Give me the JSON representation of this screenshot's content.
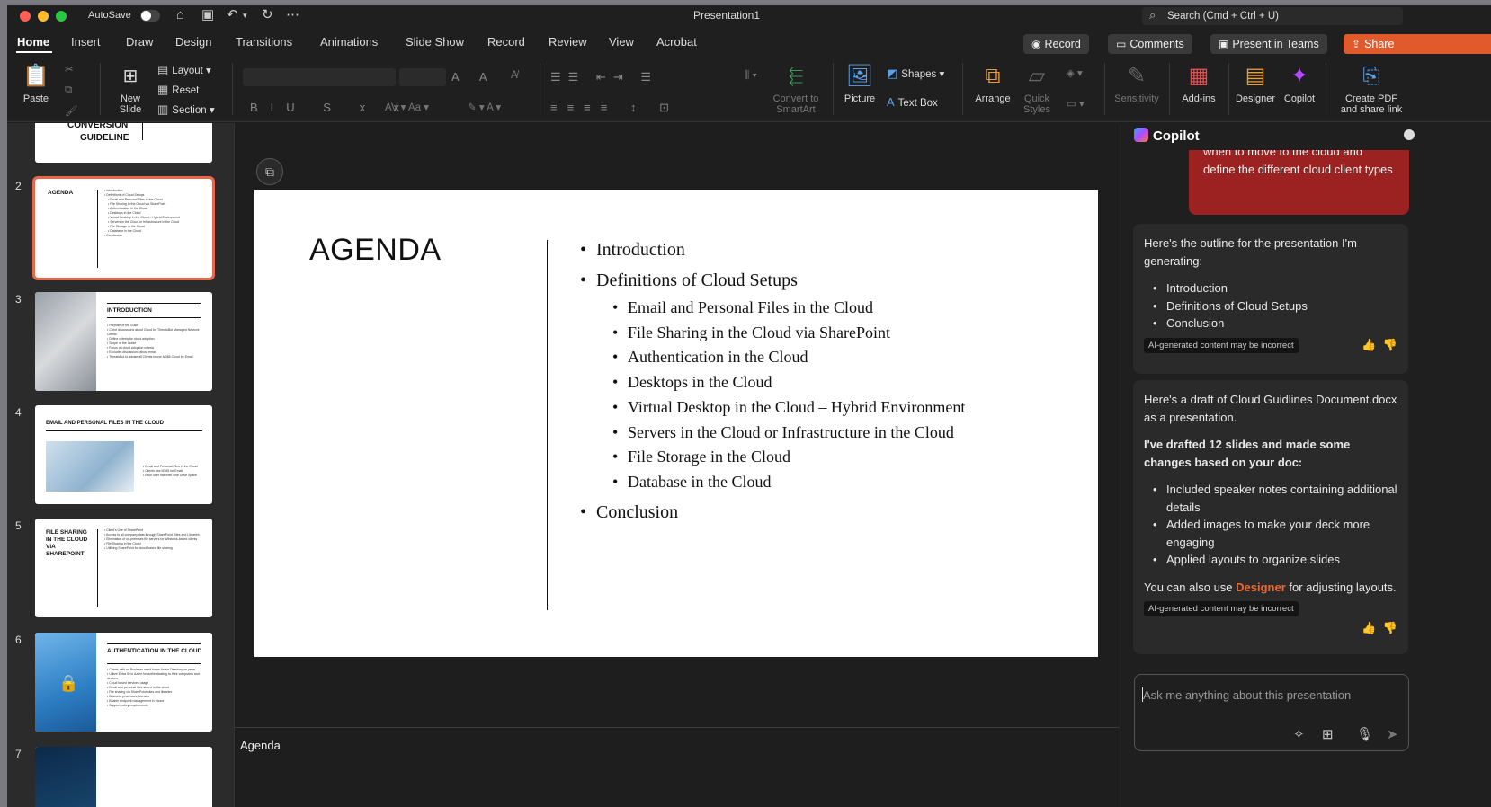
{
  "window": {
    "title": "Presentation1"
  },
  "titlebar": {
    "autosave_label": "AutoSave",
    "search_placeholder": "Search (Cmd + Ctrl + U)"
  },
  "tabs": [
    "Home",
    "Insert",
    "Draw",
    "Design",
    "Transitions",
    "Animations",
    "Slide Show",
    "Record",
    "Review",
    "View",
    "Acrobat"
  ],
  "actions": {
    "record": "Record",
    "comments": "Comments",
    "present_teams": "Present in Teams",
    "share": "Share"
  },
  "ribbon": {
    "paste": "Paste",
    "new_slide": "New\nSlide",
    "layout": "Layout",
    "reset": "Reset",
    "section": "Section",
    "convert_smartart": "Convert to\nSmartArt",
    "picture": "Picture",
    "shapes": "Shapes",
    "text_box": "Text Box",
    "arrange": "Arrange",
    "quick_styles": "Quick\nStyles",
    "sensitivity": "Sensitivity",
    "addins": "Add-ins",
    "designer": "Designer",
    "copilot": "Copilot",
    "create_pdf": "Create PDF\nand share link"
  },
  "thumbnails": {
    "slide1_title": "GUIDELINE",
    "slide1_title_cut": "CONVERSION",
    "slide2": {
      "num": "2",
      "title": "AGENDA",
      "body": [
        "• Introduction",
        "• Definitions of Cloud Setups",
        "   • Email and Personal Files in the Cloud",
        "   • File Sharing in the Cloud via SharePoint",
        "   • Authentication in the Cloud",
        "   • Desktops in the Cloud",
        "   • Virtual Desktop in the Cloud – Hybrid Environment",
        "   • Servers in the Cloud or Infrastructure in the Cloud",
        "   • File Storage in the Cloud",
        "   • Database in the Cloud",
        "• Conclusion"
      ]
    },
    "slide3": {
      "num": "3",
      "title": "INTRODUCTION",
      "body": [
        "• Purpose of the Guide",
        "   • Client discussions about Cloud for ThreatsBut Managed Network Clients",
        "   • Define criteria for cloud adoption",
        "• Scope of the Guide",
        "   • Focus on cloud adoption criteria",
        "   • Excludes discussions about email",
        "   • ThreatsBut to advise all Clients to use M365 Cloud for Email"
      ]
    },
    "slide4": {
      "num": "4",
      "title": "EMAIL AND PERSONAL FILES IN THE CLOUD",
      "body": [
        "• Email and Personal Files in the Cloud",
        "   • Clients use M365 for Email",
        "   • Each user has their One Drive Space"
      ]
    },
    "slide5": {
      "num": "5",
      "title": "FILE SHARING IN THE CLOUD VIA SHAREPOINT",
      "body": [
        "• Client's Use of SharePoint",
        "   • Access to all company data through SharePoint Sites and Libraries",
        "   • Elimination of on-premises file servers for Windows-based clients",
        "• File Sharing in the Cloud",
        "   • Utilizing SharePoint for cloud-based file sharing"
      ]
    },
    "slide6": {
      "num": "6",
      "title": "AUTHENTICATION IN THE CLOUD",
      "body": [
        "• Clients with no Business need for an Active Directory on prem",
        "   • Utilize Entra ID in Azure for authenticating to their computers and devices",
        "• Cloud based services usage",
        "   • Email and personal files stored in the cloud",
        "   • File sharing via SharePoint sites and libraries",
        "• Business processes licenses",
        "   • Enable endpoint management in Intune",
        "   • Support policy requirements"
      ]
    },
    "slide7": {
      "num": "7"
    }
  },
  "slide": {
    "title": "AGENDA",
    "bullets": {
      "b1": "Introduction",
      "b2": "Definitions of Cloud Setups",
      "s1": "Email and Personal Files in the Cloud",
      "s2": "File Sharing in the Cloud via SharePoint",
      "s3": "Authentication in the Cloud",
      "s4": "Desktops in the Cloud",
      "s5": "Virtual Desktop in the Cloud – Hybrid Environment",
      "s6": "Servers in the Cloud or Infrastructure in the Cloud",
      "s7": "File Storage in the Cloud",
      "s8": "Database in the Cloud",
      "b3": "Conclusion"
    }
  },
  "notes": {
    "text": "Agenda"
  },
  "copilot": {
    "title": "Copilot",
    "user_message_clip": "when to move to the cloud and",
    "user_message": "define the different cloud client types",
    "card1": {
      "intro": "Here's the outline for the presentation I'm generating:",
      "items": [
        "Introduction",
        "Definitions of Cloud Setups",
        "Conclusion"
      ],
      "badge": "AI-generated content may be incorrect"
    },
    "card2": {
      "intro": "Here's a draft of Cloud Guidlines Document.docx as a presentation.",
      "bold": "I've drafted 12 slides and made some changes based on your doc:",
      "items": [
        "Included speaker notes containing additional details",
        "Added images to make your deck more engaging",
        "Applied layouts to organize slides"
      ],
      "outro_pre": "You can also use ",
      "outro_link": "Designer",
      "outro_post": " for adjusting layouts.",
      "badge": "AI-generated content may be incorrect"
    },
    "input_placeholder": "Ask me anything about this presentation"
  },
  "colors": {
    "accent": "#e8674b",
    "share": "#e15a2b",
    "user_bubble": "#9c2121",
    "designer_link": "#f0682d"
  }
}
